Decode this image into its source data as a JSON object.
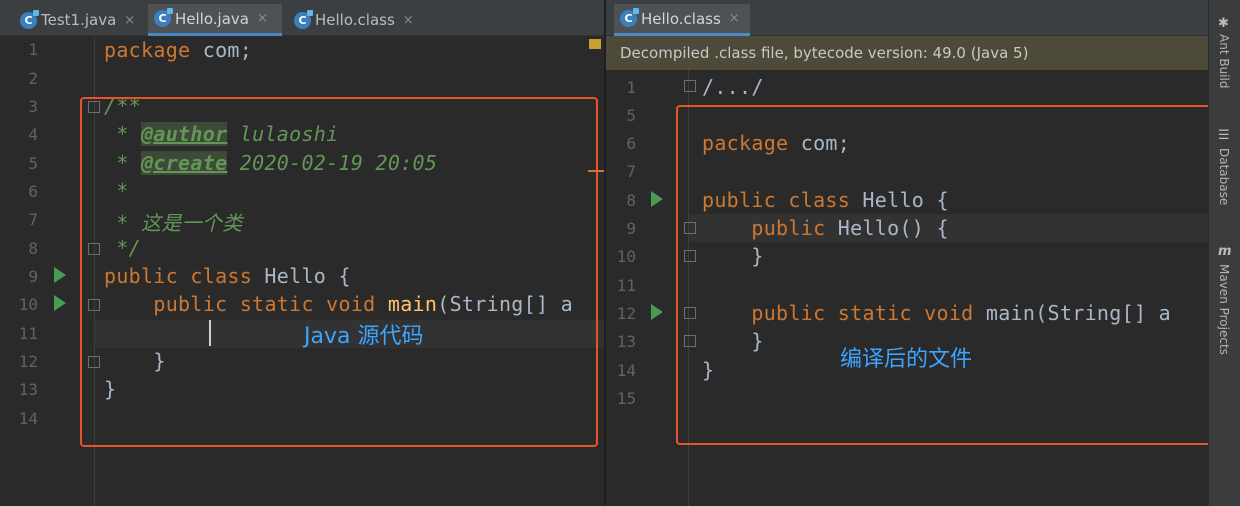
{
  "left_editor": {
    "tabs": [
      {
        "label": "Test1.java",
        "close": "×"
      },
      {
        "label": "Hello.java",
        "close": "×"
      },
      {
        "label": "Hello.class",
        "close": "×"
      }
    ],
    "line_numbers": [
      "1",
      "2",
      "3",
      "4",
      "5",
      "6",
      "7",
      "8",
      "9",
      "10",
      "11",
      "12",
      "13",
      "14"
    ],
    "annotation": "Java 源代码"
  },
  "right_editor": {
    "tabs": [
      {
        "label": "Hello.class",
        "close": "×"
      }
    ],
    "banner": "Decompiled .class file, bytecode version: 49.0 (Java 5)",
    "line_numbers": [
      "1",
      "5",
      "6",
      "7",
      "8",
      "9",
      "10",
      "11",
      "12",
      "13",
      "14",
      "15"
    ],
    "annotation": "编译后的文件"
  },
  "tool_windows": [
    {
      "label": "Ant Build",
      "icon": "ant-icon"
    },
    {
      "label": "Database",
      "icon": "database-icon"
    },
    {
      "label": "Maven Projects",
      "icon": "maven-icon"
    }
  ],
  "colors": {
    "keyword": "#cc7832",
    "method": "#ffc66d",
    "comment": "#629755",
    "highlight": "#e8542a",
    "annotation": "#3ba5ff"
  }
}
